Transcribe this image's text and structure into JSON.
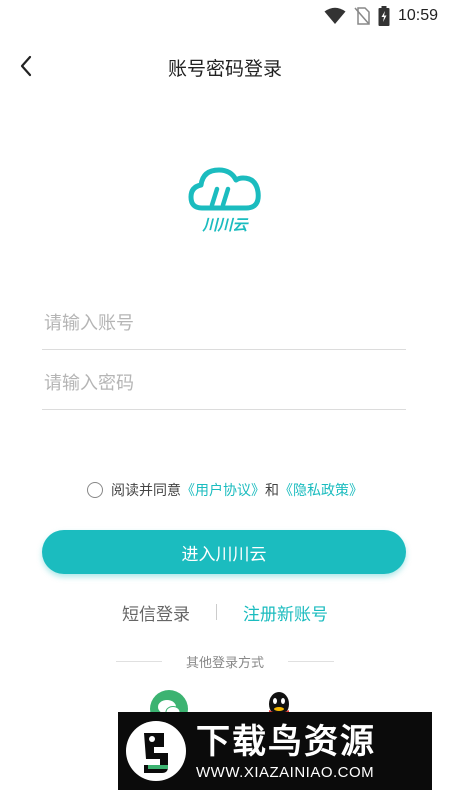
{
  "status_bar": {
    "time": "10:59"
  },
  "header": {
    "title": "账号密码登录"
  },
  "logo": {
    "text": "川川云"
  },
  "form": {
    "account_placeholder": "请输入账号",
    "password_placeholder": "请输入密码"
  },
  "agreement": {
    "prefix": "阅读并同意",
    "user_agreement": "《用户协议》",
    "and": "和",
    "privacy_policy": "《隐私政策》"
  },
  "login_button": {
    "label": "进入川川云"
  },
  "links": {
    "sms_login": "短信登录",
    "register": "注册新账号"
  },
  "other_login": {
    "title": "其他登录方式"
  },
  "watermark": {
    "title": "下载鸟资源",
    "url": "WWW.XIAZAINIAO.COM"
  },
  "colors": {
    "accent": "#1bbcbf",
    "wechat": "#3cb371",
    "qq": "#111111"
  }
}
